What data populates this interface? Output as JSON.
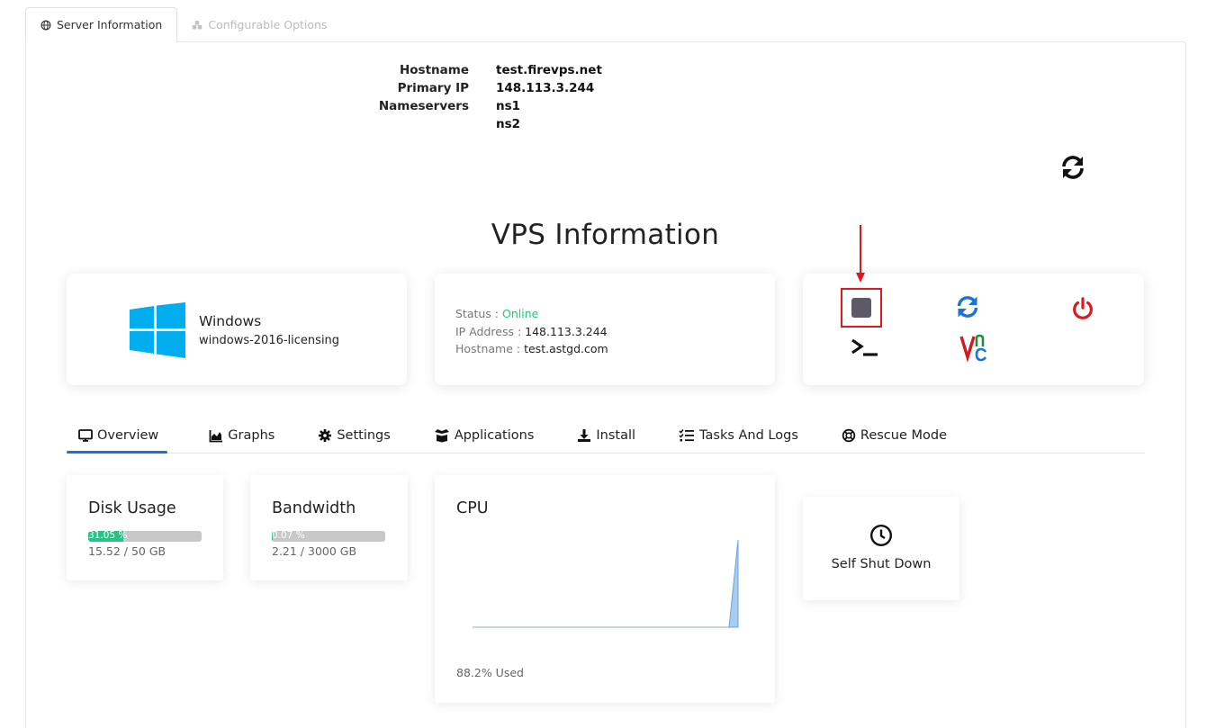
{
  "top_tabs": {
    "server_info": "Server Information",
    "configurable_options": "Configurable Options"
  },
  "server_info": {
    "hostname_label": "Hostname",
    "hostname": "test.firevps.net",
    "primary_ip_label": "Primary IP",
    "primary_ip": "148.113.3.244",
    "nameservers_label": "Nameservers",
    "ns1": "ns1",
    "ns2": "ns2"
  },
  "vps": {
    "title": "VPS Information",
    "os_name": "Windows",
    "os_version": "windows-2016-licensing",
    "status_label": "Status :",
    "status": "Online",
    "ip_label": "IP Address :",
    "ip": "148.113.3.244",
    "hostname_label": "Hostname :",
    "hostname": "test.astgd.com"
  },
  "nav_tabs": [
    "Overview",
    "Graphs",
    "Settings",
    "Applications",
    "Install",
    "Tasks And Logs",
    "Rescue Mode"
  ],
  "disk": {
    "title": "Disk Usage",
    "percent_text": "31.05 %",
    "percent": 31.05,
    "usage": "15.52 / 50 GB"
  },
  "bandwidth": {
    "title": "Bandwidth",
    "percent_text": "0.07 %",
    "percent": 0.07,
    "usage": "2.21 / 3000 GB"
  },
  "cpu": {
    "title": "CPU",
    "used": "88.2% Used"
  },
  "self_shutdown": {
    "label": "Self Shut Down"
  },
  "colors": {
    "accent": "#1a73d9",
    "online": "#1ec97a",
    "progress": "#25c485",
    "power": "#e0171d",
    "windows": "#00adef"
  }
}
